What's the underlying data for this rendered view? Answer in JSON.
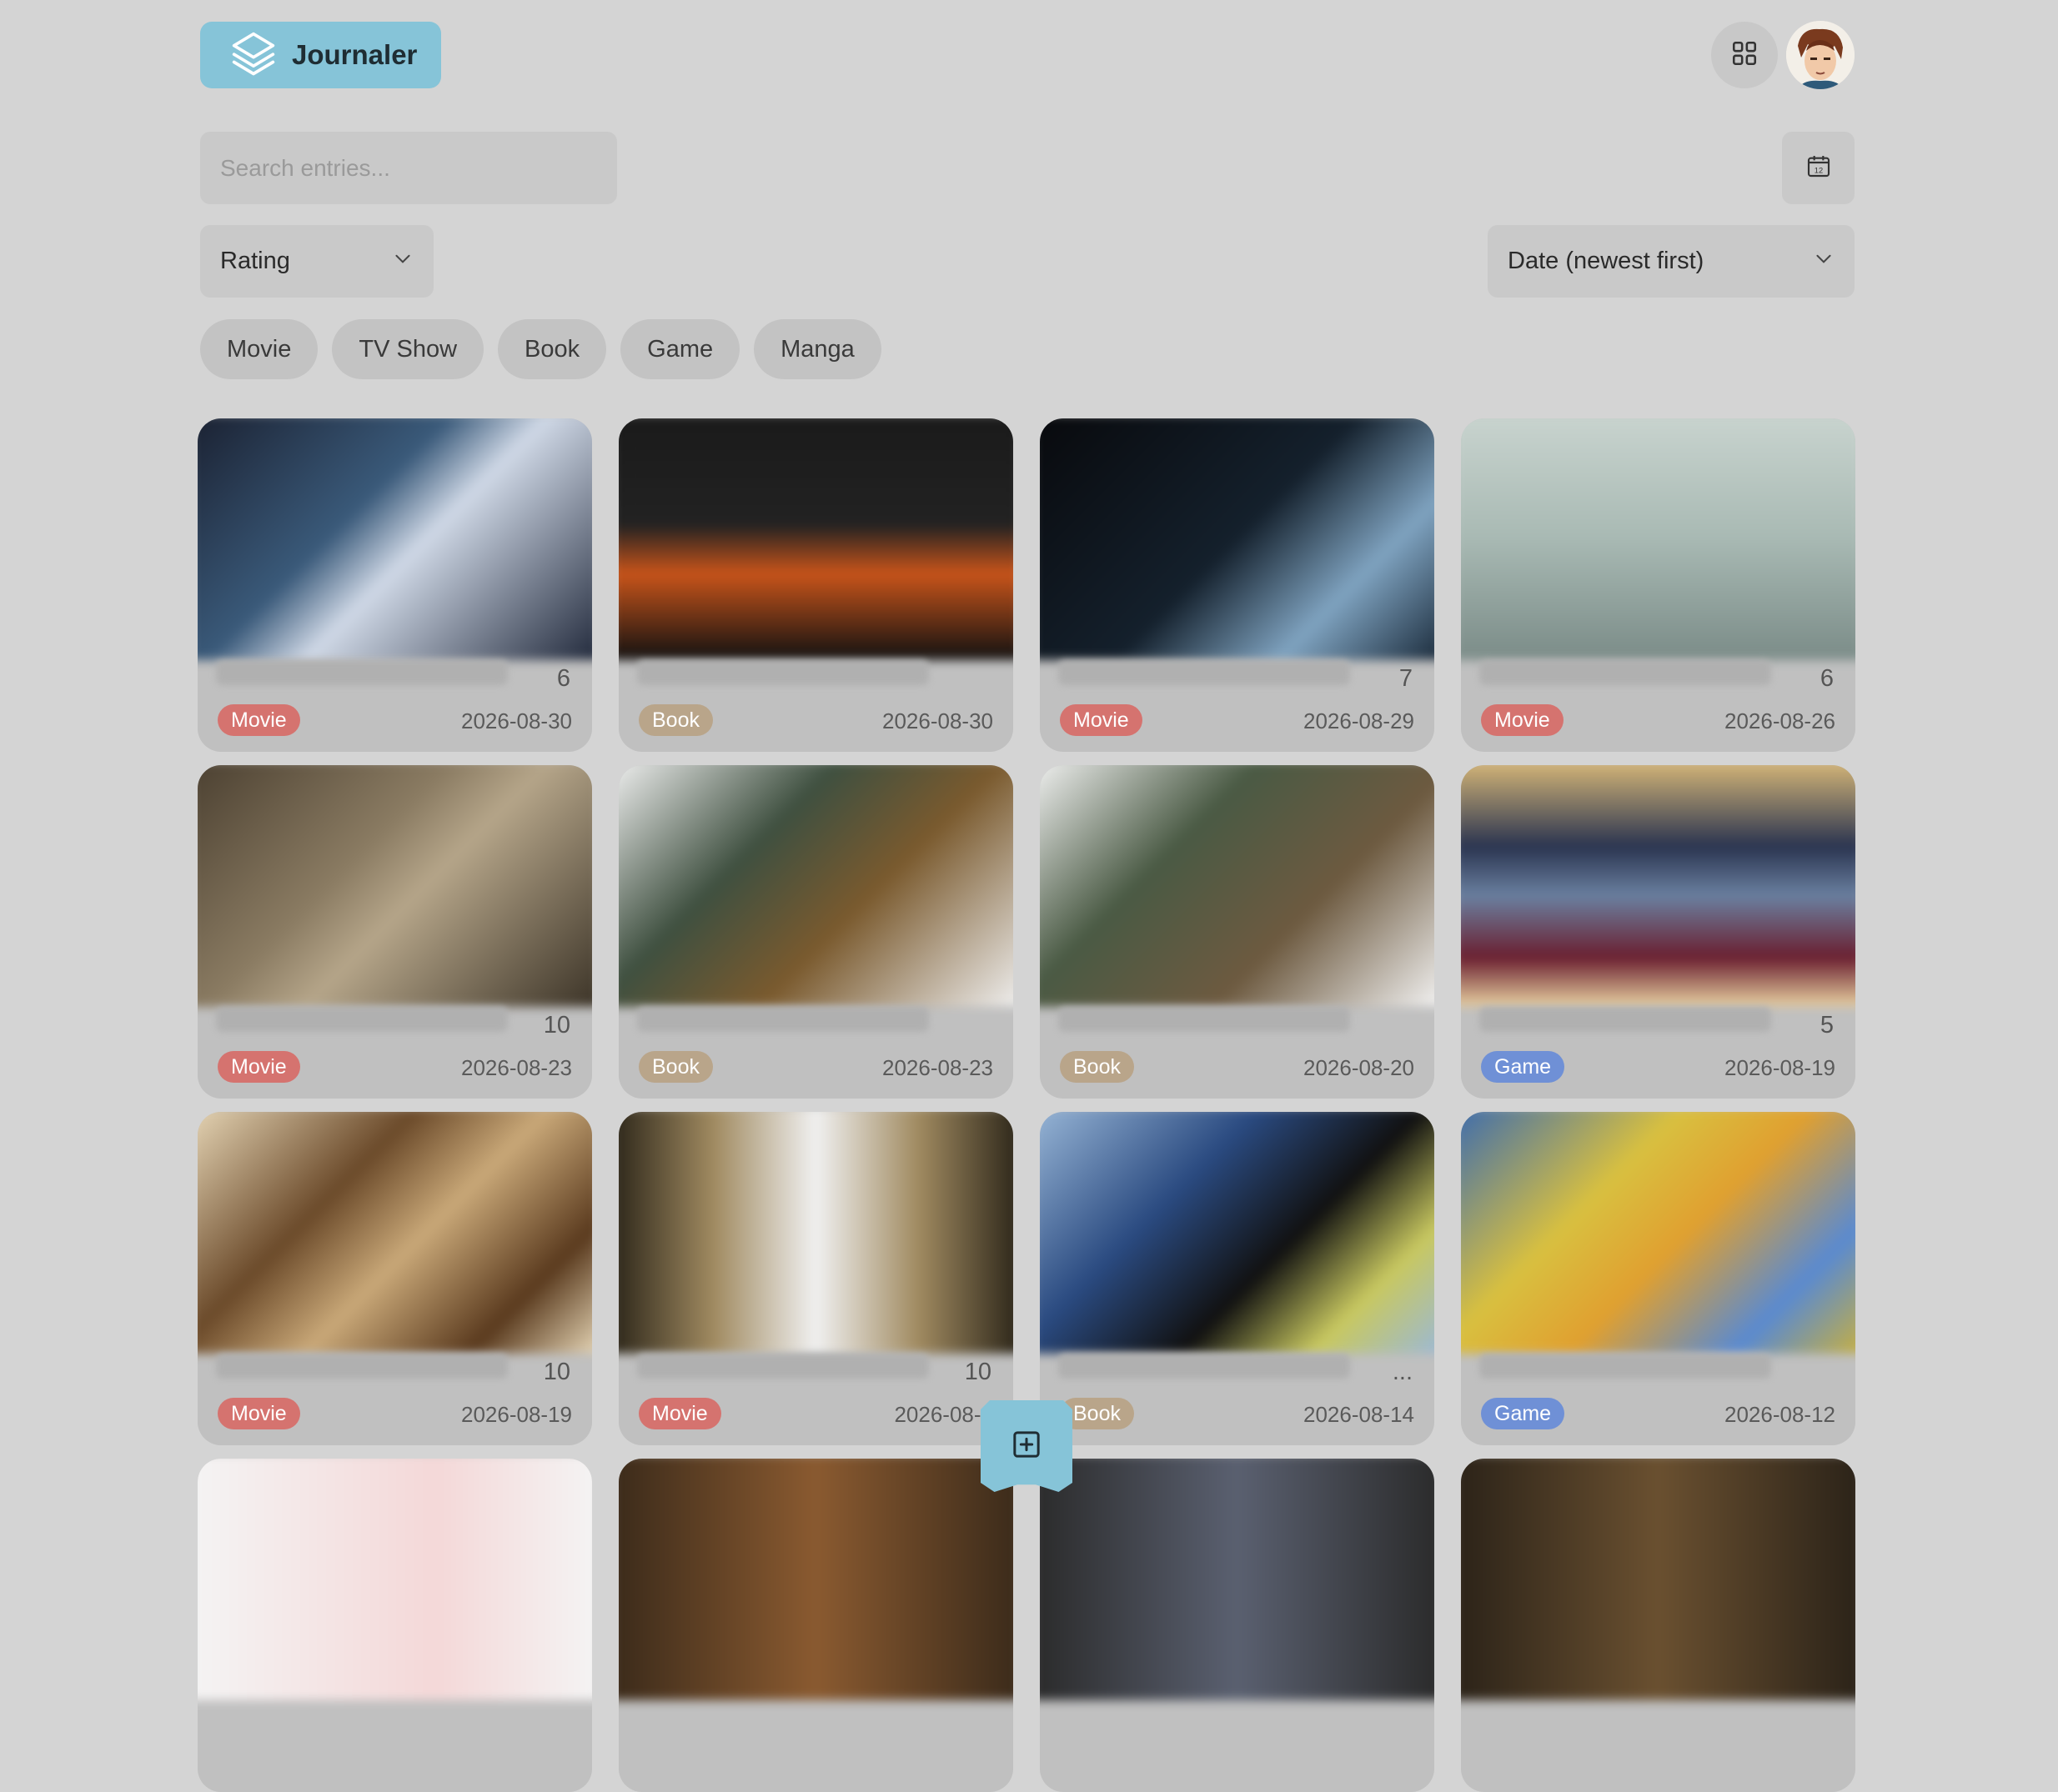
{
  "app": {
    "name": "Journaler"
  },
  "search": {
    "placeholder": "Search entries..."
  },
  "filters": {
    "rating_label": "Rating",
    "sort_label": "Date (newest first)"
  },
  "chips": [
    "Movie",
    "TV Show",
    "Book",
    "Game",
    "Manga"
  ],
  "cards": [
    {
      "rating": "6",
      "type": "Movie",
      "date": "2026-08-30",
      "img": "linear-gradient(135deg,#1a2030 0%,#3a5a7a 40%,#cfd8e6 55%,#20283a 100%)"
    },
    {
      "rating": "",
      "type": "Book",
      "date": "2026-08-30",
      "img": "linear-gradient(180deg,#1a1a1a 0%,#222 45%,#c8541a 65%,#111 100%)"
    },
    {
      "rating": "7",
      "type": "Movie",
      "date": "2026-08-29",
      "img": "linear-gradient(135deg,#08090c 0%,#14202c 50%,#7fa3c0 75%,#1a2a3a 100%)"
    },
    {
      "rating": "6",
      "type": "Movie",
      "date": "2026-08-26",
      "img": "linear-gradient(180deg,#c9d4cf 0%,#a9bab4 50%,#7b8c88 100%)"
    },
    {
      "rating": "10",
      "type": "Movie",
      "date": "2026-08-23",
      "img": "linear-gradient(135deg,#4a3f30 0%,#8a7b62 40%,#b5a589 55%,#3a3226 100%)"
    },
    {
      "rating": "",
      "type": "Book",
      "date": "2026-08-23",
      "img": "linear-gradient(135deg,#f2f2f2 0%,#3f5040 35%,#7a5a2e 60%,#f0f0f0 100%)"
    },
    {
      "rating": "",
      "type": "Book",
      "date": "2026-08-20",
      "img": "linear-gradient(135deg,#f4f4f4 0%,#4a5a44 35%,#6d5a40 65%,#f4f4f4 100%)"
    },
    {
      "rating": "5",
      "type": "Game",
      "date": "2026-08-19",
      "img": "linear-gradient(180deg,#d8b878 0%,#2a3450 35%,#6a80a0 55%,#6a1f30 80%,#e8d0a0 100%)"
    },
    {
      "rating": "10",
      "type": "Movie",
      "date": "2026-08-19",
      "img": "linear-gradient(135deg,#e8d8b8 0%,#6b4a2a 35%,#c9a878 55%,#5a3a1e 80%,#e8d8b8 100%)"
    },
    {
      "rating": "10",
      "type": "Movie",
      "date": "2026-08-1",
      "img": "linear-gradient(90deg,#2a2418 0%,#a08a60 25%,#f0f0f0 50%,#a08a60 75%,#2a2418 100%)"
    },
    {
      "rating": "...",
      "type": "Book",
      "date": "2026-08-14",
      "img": "linear-gradient(135deg,#9ab8d8 0%,#2a4a80 35%,#111 60%,#c8c860 80%,#9ab8d8 100%)"
    },
    {
      "rating": "",
      "type": "Game",
      "date": "2026-08-12",
      "img": "linear-gradient(135deg,#3a6ab0 0%,#d8c040 35%,#e0a030 55%,#5a8ad0 80%,#c8b040 100%)"
    },
    {
      "rating": "",
      "type": "",
      "date": "",
      "img": "linear-gradient(90deg,#f4f4f4 0%,#f4d8d8 60%,#f4f4f4 100%)"
    },
    {
      "rating": "",
      "type": "",
      "date": "",
      "img": "linear-gradient(90deg,#3a2a1a 0%,#8a5a30 50%,#3a2a1a 100%)"
    },
    {
      "rating": "",
      "type": "",
      "date": "",
      "img": "linear-gradient(90deg,#2a2a2a 0%,#5a6070 50%,#2a2a2a 100%)"
    },
    {
      "rating": "",
      "type": "",
      "date": "",
      "img": "linear-gradient(90deg,#2a2218 0%,#6a5030 50%,#2a2218 100%)"
    }
  ],
  "colors": {
    "accent": "#86c4d8",
    "movie_badge": "#d5736f",
    "book_badge": "#b9a58a",
    "game_badge": "#6f90d6"
  },
  "icons": {
    "logo": "layers-icon",
    "grid_toggle": "grid-icon",
    "calendar": "calendar-icon",
    "add": "plus-square-icon"
  }
}
